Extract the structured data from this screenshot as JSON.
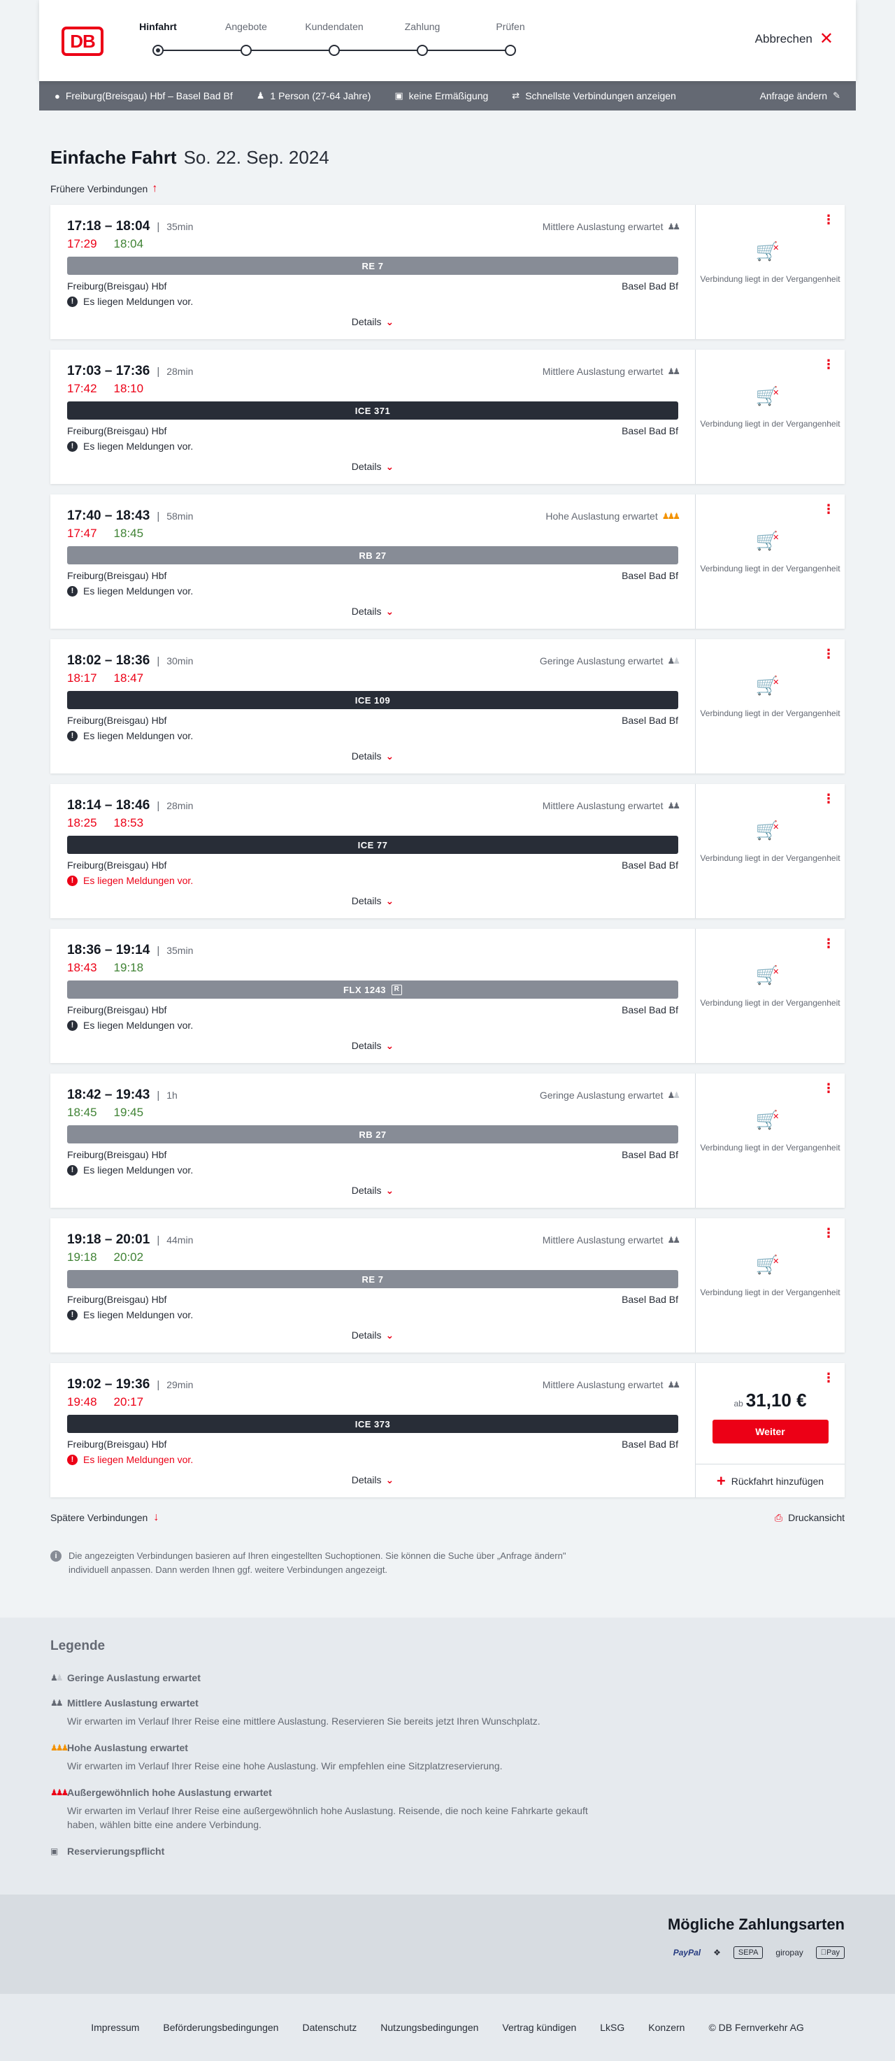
{
  "header": {
    "logo": "DB",
    "steps": [
      {
        "label": "Hinfahrt"
      },
      {
        "label": "Angebote"
      },
      {
        "label": "Kundendaten"
      },
      {
        "label": "Zahlung"
      },
      {
        "label": "Prüfen"
      }
    ],
    "cancel_label": "Abbrechen"
  },
  "query": {
    "route": "Freiburg(Breisgau) Hbf – Basel Bad Bf",
    "travellers": "1 Person (27-64 Jahre)",
    "discount": "keine Ermäßigung",
    "option": "Schnellste Verbindungen anzeigen",
    "change_label": "Anfrage ändern"
  },
  "title": {
    "main": "Einfache Fahrt",
    "date": "So. 22. Sep. 2024"
  },
  "earlier_label": "Frühere Verbindungen",
  "connections": [
    {
      "times": "17:18 – 18:04",
      "duration": "35min",
      "rt_dep": "17:29",
      "rt_arr": "18:04",
      "dep_late": true,
      "arr_late": false,
      "load": "Mittlere Auslastung erwartet",
      "load_icon": "load-medium-icon",
      "train": "RE 7",
      "train_type": "regional",
      "reservation": false,
      "from": "Freiburg(Breisgau) Hbf",
      "to": "Basel Bad Bf",
      "notice": "Es liegen Meldungen vor.",
      "notice_alert": false,
      "details": "Details",
      "past_text": "Verbindung liegt in der Vergangenheit"
    },
    {
      "times": "17:03 – 17:36",
      "duration": "28min",
      "rt_dep": "17:42",
      "rt_arr": "18:10",
      "dep_late": true,
      "arr_late": true,
      "load": "Mittlere Auslastung erwartet",
      "load_icon": "load-medium-icon",
      "train": "ICE 371",
      "train_type": "ice",
      "reservation": false,
      "from": "Freiburg(Breisgau) Hbf",
      "to": "Basel Bad Bf",
      "notice": "Es liegen Meldungen vor.",
      "notice_alert": false,
      "details": "Details",
      "past_text": "Verbindung liegt in der Vergangenheit"
    },
    {
      "times": "17:40 – 18:43",
      "duration": "58min",
      "rt_dep": "17:47",
      "rt_arr": "18:45",
      "dep_late": true,
      "arr_late": false,
      "load": "Hohe Auslastung erwartet",
      "load_icon": "load-high-icon",
      "train": "RB 27",
      "train_type": "regional",
      "reservation": false,
      "from": "Freiburg(Breisgau) Hbf",
      "to": "Basel Bad Bf",
      "notice": "Es liegen Meldungen vor.",
      "notice_alert": false,
      "details": "Details",
      "past_text": "Verbindung liegt in der Vergangenheit"
    },
    {
      "times": "18:02 – 18:36",
      "duration": "30min",
      "rt_dep": "18:17",
      "rt_arr": "18:47",
      "dep_late": true,
      "arr_late": true,
      "load": "Geringe Auslastung erwartet",
      "load_icon": "load-low-icon",
      "train": "ICE 109",
      "train_type": "ice",
      "reservation": false,
      "from": "Freiburg(Breisgau) Hbf",
      "to": "Basel Bad Bf",
      "notice": "Es liegen Meldungen vor.",
      "notice_alert": false,
      "details": "Details",
      "past_text": "Verbindung liegt in der Vergangenheit"
    },
    {
      "times": "18:14 – 18:46",
      "duration": "28min",
      "rt_dep": "18:25",
      "rt_arr": "18:53",
      "dep_late": true,
      "arr_late": true,
      "load": "Mittlere Auslastung erwartet",
      "load_icon": "load-medium-icon",
      "train": "ICE 77",
      "train_type": "ice",
      "reservation": false,
      "from": "Freiburg(Breisgau) Hbf",
      "to": "Basel Bad Bf",
      "notice": "Es liegen Meldungen vor.",
      "notice_alert": true,
      "details": "Details",
      "past_text": "Verbindung liegt in der Vergangenheit"
    },
    {
      "times": "18:36 – 19:14",
      "duration": "35min",
      "rt_dep": "18:43",
      "rt_arr": "19:18",
      "dep_late": true,
      "arr_late": false,
      "load": "",
      "load_icon": "",
      "train": "FLX 1243",
      "train_type": "regional",
      "reservation": true,
      "reservation_mark": "R",
      "from": "Freiburg(Breisgau) Hbf",
      "to": "Basel Bad Bf",
      "notice": "Es liegen Meldungen vor.",
      "notice_alert": false,
      "details": "Details",
      "past_text": "Verbindung liegt in der Vergangenheit"
    },
    {
      "times": "18:42 – 19:43",
      "duration": "1h",
      "rt_dep": "18:45",
      "rt_arr": "19:45",
      "dep_late": false,
      "arr_late": false,
      "load": "Geringe Auslastung erwartet",
      "load_icon": "load-low-icon",
      "train": "RB 27",
      "train_type": "regional",
      "reservation": false,
      "from": "Freiburg(Breisgau) Hbf",
      "to": "Basel Bad Bf",
      "notice": "Es liegen Meldungen vor.",
      "notice_alert": false,
      "details": "Details",
      "past_text": "Verbindung liegt in der Vergangenheit"
    },
    {
      "times": "19:18 – 20:01",
      "duration": "44min",
      "rt_dep": "19:18",
      "rt_arr": "20:02",
      "dep_late": false,
      "arr_late": false,
      "load": "Mittlere Auslastung erwartet",
      "load_icon": "load-medium-icon",
      "train": "RE 7",
      "train_type": "regional",
      "reservation": false,
      "from": "Freiburg(Breisgau) Hbf",
      "to": "Basel Bad Bf",
      "notice": "Es liegen Meldungen vor.",
      "notice_alert": false,
      "details": "Details",
      "past_text": "Verbindung liegt in der Vergangenheit"
    },
    {
      "times": "19:02 – 19:36",
      "duration": "29min",
      "rt_dep": "19:48",
      "rt_arr": "20:17",
      "dep_late": true,
      "arr_late": true,
      "load": "Mittlere Auslastung erwartet",
      "load_icon": "load-medium-icon",
      "train": "ICE 373",
      "train_type": "ice",
      "reservation": false,
      "from": "Freiburg(Breisgau) Hbf",
      "to": "Basel Bad Bf",
      "notice": "Es liegen Meldungen vor.",
      "notice_alert": true,
      "details": "Details",
      "offer": {
        "prefix": "ab",
        "price": "31,10 €",
        "button": "Weiter",
        "return_trip": "Rückfahrt hinzufügen"
      }
    }
  ],
  "later_label": "Spätere Verbindungen",
  "print_label": "Druckansicht",
  "info_note": "Die angezeigten Verbindungen basieren auf Ihren eingestellten Suchoptionen. Sie können die Suche über „Anfrage ändern\" individuell anpassen. Dann werden Ihnen ggf. weitere Verbindungen angezeigt.",
  "legend": {
    "title": "Legende",
    "items": [
      {
        "icon": "load-low-icon",
        "title": "Geringe Auslastung erwartet",
        "desc": ""
      },
      {
        "icon": "load-medium-icon",
        "title": "Mittlere Auslastung erwartet",
        "desc": "Wir erwarten im Verlauf Ihrer Reise eine mittlere Auslastung. Reservieren Sie bereits jetzt Ihren Wunschplatz."
      },
      {
        "icon": "load-high-icon",
        "title": "Hohe Auslastung erwartet",
        "desc": "Wir erwarten im Verlauf Ihrer Reise eine hohe Auslastung. Wir empfehlen eine Sitzplatzreservierung."
      },
      {
        "icon": "load-extreme-icon",
        "title": "Außergewöhnlich hohe Auslastung erwartet",
        "desc": "Wir erwarten im Verlauf Ihrer Reise eine außergewöhnlich hohe Auslastung. Reisende, die noch keine Fahrkarte gekauft haben, wählen bitte eine andere Verbindung."
      },
      {
        "icon": "reservation-required-icon",
        "title": "Reservierungspflicht",
        "desc": ""
      }
    ]
  },
  "payments": {
    "title": "Mögliche Zahlungsarten",
    "methods": [
      {
        "name": "paypal-icon",
        "label": "PayPal"
      },
      {
        "name": "contactless-icon",
        "label": ""
      },
      {
        "name": "sepa-icon",
        "label": "SEPA"
      },
      {
        "name": "giropay-icon",
        "label": "giropay"
      },
      {
        "name": "apple-pay-icon",
        "label": "Pay"
      }
    ]
  },
  "footer": {
    "links": [
      "Impressum",
      "Beförderungsbedingungen",
      "Datenschutz",
      "Nutzungsbedingungen",
      "Vertrag kündigen",
      "LkSG",
      "Konzern",
      "© DB Fernverkehr AG"
    ]
  },
  "colors": {
    "brand": "#ec0016",
    "late": "#ec0016",
    "ontime": "#408335",
    "ice_bar": "#282d37",
    "regional_bar": "#878c96"
  }
}
